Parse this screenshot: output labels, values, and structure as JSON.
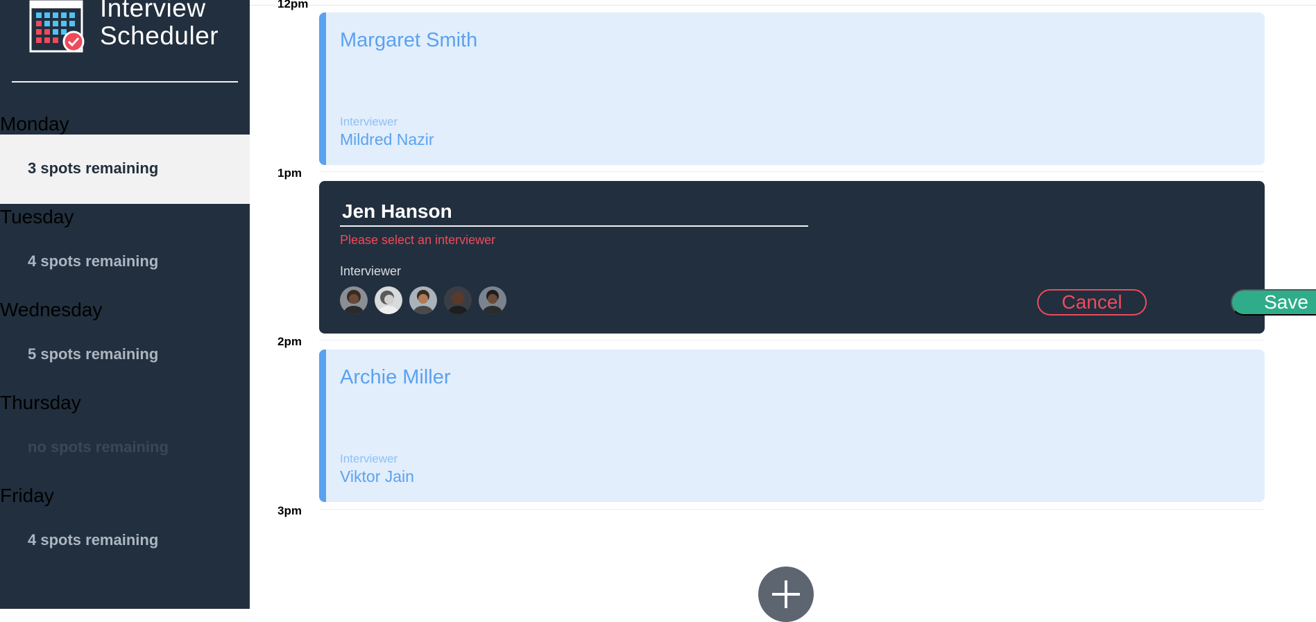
{
  "app": {
    "title_line1": "Interview",
    "title_line2": "Scheduler"
  },
  "days": [
    {
      "name": "Monday",
      "spots": "3 spots remaining",
      "selected": true
    },
    {
      "name": "Tuesday",
      "spots": "4 spots remaining"
    },
    {
      "name": "Wednesday",
      "spots": "5 spots remaining"
    },
    {
      "name": "Thursday",
      "spots": "no spots remaining"
    },
    {
      "name": "Friday",
      "spots": "4 spots remaining"
    }
  ],
  "times": [
    "12pm",
    "1pm",
    "2pm",
    "3pm"
  ],
  "appointments": [
    {
      "student": "Margaret Smith",
      "interviewer_label": "Interviewer",
      "interviewer": "Mildred Nazir"
    },
    {
      "student": "Archie Miller",
      "interviewer_label": "Interviewer",
      "interviewer": "Viktor Jain"
    }
  ],
  "form": {
    "student_value": "Jen Hanson",
    "validation": "Please select an interviewer",
    "interviewer_label": "Interviewer",
    "cancel": "Cancel",
    "save": "Save"
  },
  "colors": {
    "sidebar": "#222f3e",
    "accent_blue": "#5aa2ef",
    "card_bg": "#e2eefc",
    "danger": "#ef4a5b",
    "confirm": "#2fad8a"
  }
}
